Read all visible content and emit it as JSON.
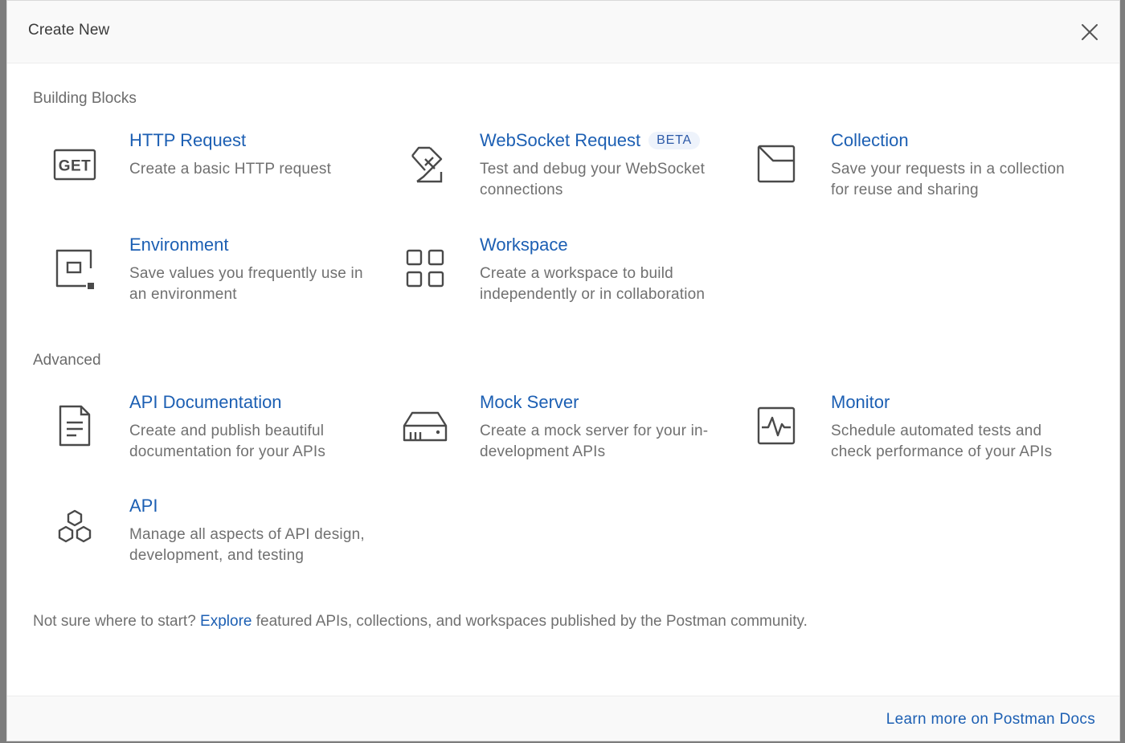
{
  "modal": {
    "title": "Create New",
    "close_icon": "close-icon"
  },
  "sections": [
    {
      "title": "Building Blocks",
      "items": [
        {
          "icon": "get-request-icon",
          "title": "HTTP Request",
          "description": "Create a basic HTTP request"
        },
        {
          "icon": "websocket-icon",
          "title": "WebSocket Request",
          "badge": "BETA",
          "description": "Test and debug your WebSocket connections"
        },
        {
          "icon": "collection-icon",
          "title": "Collection",
          "description": "Save your requests in a collection for reuse and sharing"
        },
        {
          "icon": "environment-icon",
          "title": "Environment",
          "description": "Save values you frequently use in an environment"
        },
        {
          "icon": "workspace-icon",
          "title": "Workspace",
          "description": "Create a workspace to build independently or in collaboration"
        }
      ]
    },
    {
      "title": "Advanced",
      "items": [
        {
          "icon": "document-icon",
          "title": "API Documentation",
          "description": "Create and publish beautiful documentation for your APIs"
        },
        {
          "icon": "server-icon",
          "title": "Mock Server",
          "description": "Create a mock server for your in-development APIs"
        },
        {
          "icon": "monitor-icon",
          "title": "Monitor",
          "description": "Schedule automated tests and check performance of your APIs"
        },
        {
          "icon": "hexagons-icon",
          "title": "API",
          "description": "Manage all aspects of API design, development, and testing"
        }
      ]
    }
  ],
  "footer_note": {
    "prefix": "Not sure where to start?",
    "link": "Explore",
    "suffix": "featured APIs, collections, and workspaces published by the Postman community."
  },
  "footer": {
    "docs_link": "Learn more on Postman Docs"
  },
  "colors": {
    "link": "#1c5fb3",
    "text_muted": "#707070",
    "icon_stroke": "#4a4a4a"
  }
}
